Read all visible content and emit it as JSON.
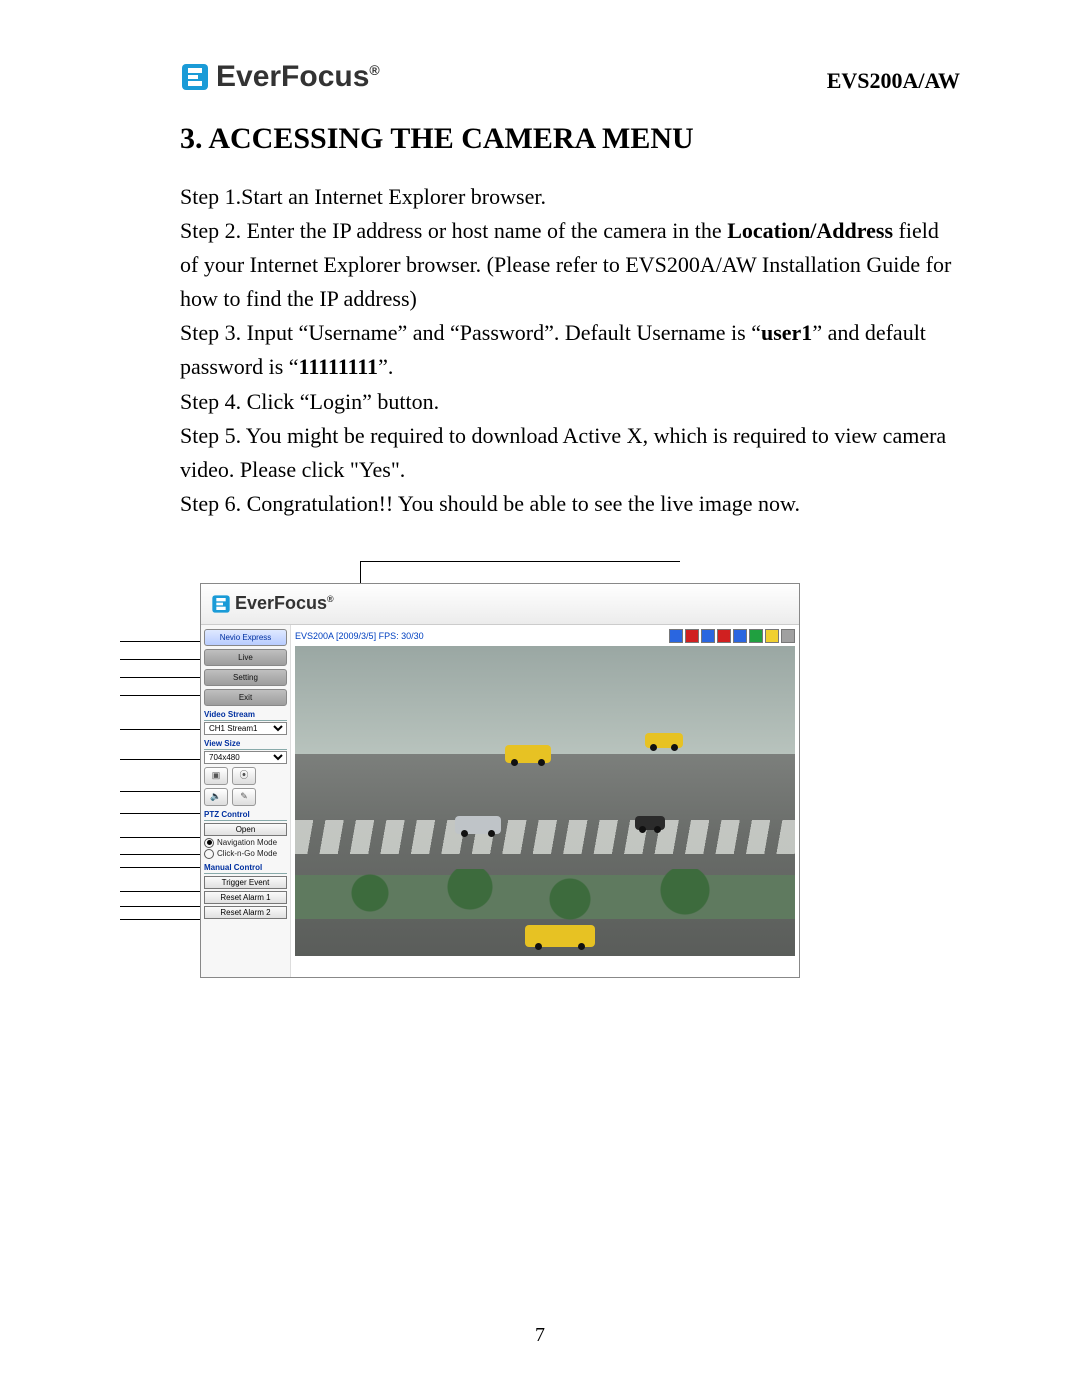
{
  "header": {
    "brand": "EverFocus",
    "trademark": "®",
    "model": "EVS200A/AW"
  },
  "title": "3. ACCESSING THE CAMERA MENU",
  "steps": {
    "s1": "Step 1.Start an Internet Explorer browser.",
    "s2a": "Step 2. Enter the IP address or host name of the camera in the ",
    "s2b": "Location/Address",
    "s2c": " field of your Internet Explorer browser. (Please refer to EVS200A/AW Installation Guide for how to find the IP address)",
    "s3a": "Step 3. Input “Username” and “Password”. Default Username is “",
    "s3b": "user1",
    "s3c": "” and default password is “",
    "s3d": "11111111",
    "s3e": "”.",
    "s4": "Step 4. Click “Login” button.",
    "s5": "Step 5. You might be required to download Active X, which is required to view camera video. Please click \"Yes\".",
    "s6": "Step 6. Congratulation!! You should be able to see the live image now."
  },
  "screenshot": {
    "brand": "EverFocus",
    "trademark": "®",
    "caption": "EVS200A [2009/3/5] FPS: 30/30",
    "nav": {
      "nevio": "Nevio Express",
      "live": "Live",
      "setting": "Setting",
      "exit": "Exit"
    },
    "videoStream": {
      "label": "Video Stream",
      "value": "CH1 Stream1"
    },
    "viewSize": {
      "label": "View Size",
      "value": "704x480"
    },
    "ptz": {
      "label": "PTZ Control",
      "open": "Open",
      "nav": "Navigation Mode",
      "cng": "Click-n-Go Mode"
    },
    "manual": {
      "label": "Manual Control",
      "trigger": "Trigger Event",
      "ra1": "Reset Alarm 1",
      "ra2": "Reset Alarm 2"
    }
  },
  "pageNumber": "7"
}
